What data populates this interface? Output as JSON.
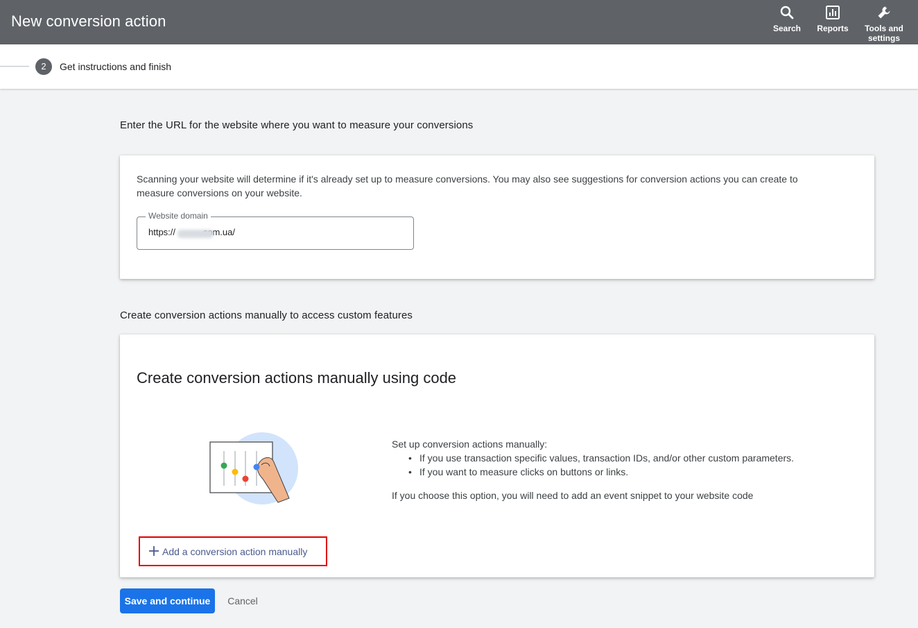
{
  "header": {
    "title": "New conversion action",
    "tools": [
      {
        "label": "Search",
        "icon": "search-icon"
      },
      {
        "label": "Reports",
        "icon": "reports-icon"
      },
      {
        "label": "Tools and settings",
        "icon": "wrench-icon"
      }
    ]
  },
  "stepper": {
    "step_number": "2",
    "step_label": "Get instructions and finish"
  },
  "url_section": {
    "heading": "Enter the URL for the website where you want to measure your conversions",
    "description": "Scanning your website will determine if it's already set up to measure conversions. You may also see suggestions for conversion actions you can create to measure conversions on your website.",
    "field_label": "Website domain",
    "field_value": "https://          .com.ua/"
  },
  "manual_section": {
    "heading": "Create conversion actions manually to access custom features",
    "card_title": "Create conversion actions manually using code",
    "intro": "Set up conversion actions manually:",
    "bullets": [
      "If you use transaction specific values, transaction IDs, and/or other custom parameters.",
      "If you want to measure clicks on buttons or links."
    ],
    "note": "If you choose this option, you will need to add an event snippet to your website code",
    "add_label": "Add a conversion action manually"
  },
  "footer": {
    "save_label": "Save and continue",
    "cancel_label": "Cancel"
  },
  "colors": {
    "topbar": "#5f6368",
    "primary": "#1a73e8",
    "highlight": "#e00000"
  }
}
